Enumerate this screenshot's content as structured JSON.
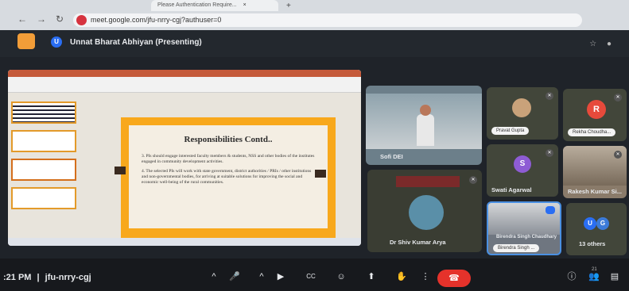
{
  "browser": {
    "tab_title": "Please Authentication Require...",
    "tab_close": "×",
    "new_tab": "+",
    "back": "←",
    "forward": "→",
    "reload": "↻",
    "url": "meet.google.com/jfu-nrry-cgj?authuser=0"
  },
  "meet": {
    "presenter_initial": "U",
    "presenting_label": "Unnat Bharat Abhiyan (Presenting)",
    "meeting_code": "jfu-nrry-cgj",
    "time": ":21 PM",
    "separator": "|",
    "participant_count": "21"
  },
  "slide": {
    "title": "Responsibilities Contd..",
    "points": [
      "3. PIs should engage interested faculty members & students, NSS and other bodies of the institutes engaged in community development activities.",
      "4. The selected PIs will work with state government, district authorities / PRIs / other institutions and non-governmental bodies, for arriving at suitable solutions for improving the social and economic well-being of the rural communities."
    ]
  },
  "tiles": {
    "sofi_det": "Sofi DEI",
    "pravat": "Pravat Gupta",
    "rekha": "Rekha Choudha...",
    "rekha_initial": "R",
    "swati": "Swati Agarwal",
    "swati_initial": "S",
    "rakesh": "Rakesh Kumar Si...",
    "shiv": "Dr Shiv Kumar Arya",
    "birendra": "Birendra Singh Chaudhary",
    "birendra_pill": "Birendra Singh ...",
    "others": "13 others",
    "others_initials": [
      "U",
      "G"
    ]
  },
  "controls": {
    "caret": "^",
    "mic": "🎤",
    "camera": "▶",
    "captions": "CC",
    "emoji": "☺",
    "present": "⬆",
    "hand": "✋",
    "more": "⋮",
    "end": "☎",
    "info": "ⓘ",
    "people": "👥",
    "chat": "▤"
  },
  "colors": {
    "end_call": "#e5322b",
    "presenter_badge": "#2a6ef3",
    "slide_border": "#f8a81c",
    "avatar_red": "#e74a3b",
    "avatar_purple": "#8e5cd4"
  }
}
